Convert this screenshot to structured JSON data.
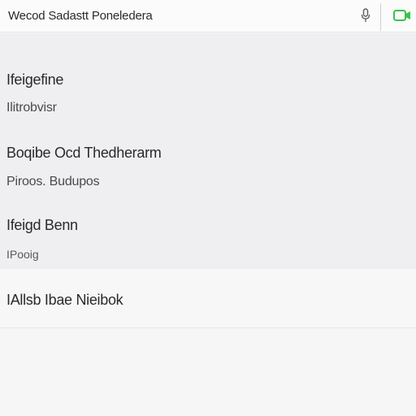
{
  "topbar": {
    "title": "Wecod Sadastt Poneledera",
    "mic_icon": "microphone-icon",
    "action_icon": "video-call-icon",
    "accent_color": "#3cc24b"
  },
  "details": {
    "items": [
      {
        "heading": "Ifeigefine",
        "sub": "Ilitrobvisr"
      },
      {
        "heading": "Boqibe Ocd Thedherarm",
        "sub": "Piroos. Budupos"
      },
      {
        "heading": "Ifeigd Benn",
        "sub": "IPooig"
      }
    ]
  },
  "section": {
    "label": "IAllsb Ibae Nieibok"
  }
}
